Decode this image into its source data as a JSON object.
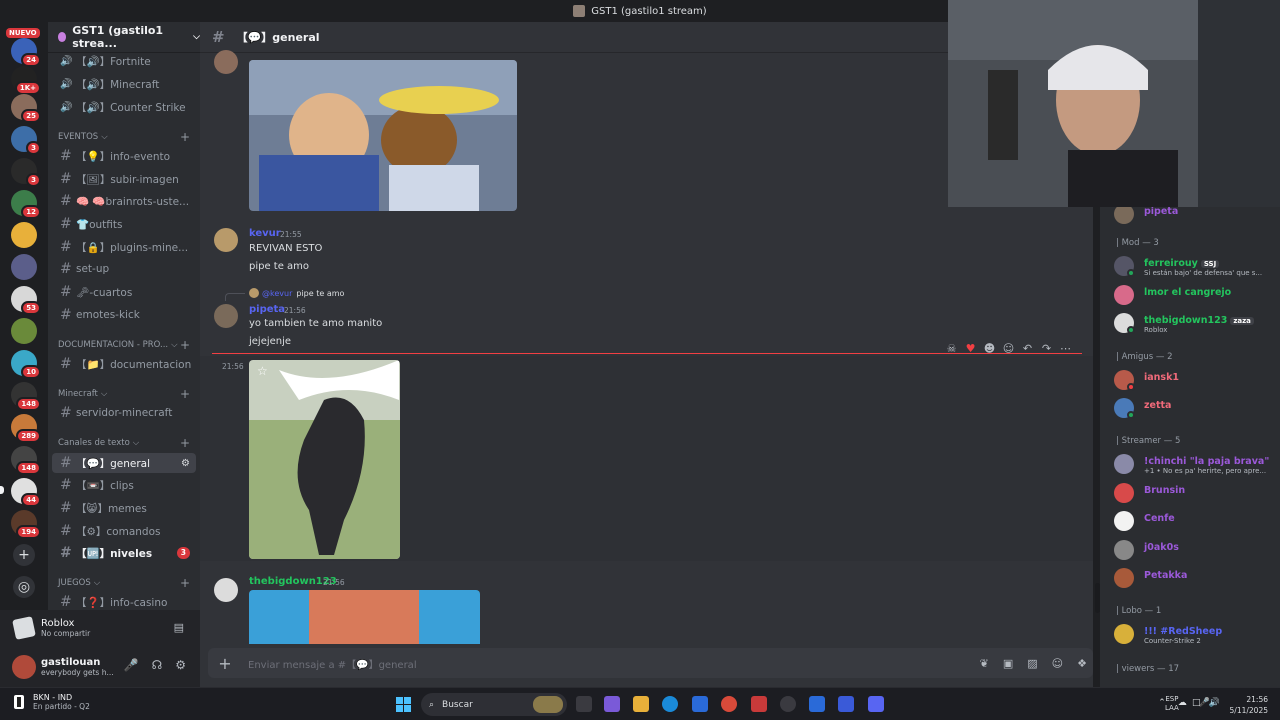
{
  "window": {
    "title": "GST1 (gastilo1 stream)"
  },
  "rail": {
    "new_badge": "NUEVO",
    "badges": [
      "24",
      "1K+",
      "25",
      "3",
      "3",
      "12",
      "53",
      "10",
      "148",
      "289",
      "148",
      "44",
      "194"
    ]
  },
  "server": {
    "name": "GST1 (gastilo1 strea..."
  },
  "channels": {
    "voice": [
      "【🔊】Fortnite",
      "【🔊】Minecraft",
      "【🔊】Counter Strike"
    ],
    "cat_eventos": "EVENTOS",
    "eventos": [
      "【💡】info-evento",
      "【🖼】subir-imagen",
      "🧠 🧠brainrots-uste...",
      "👕outfits",
      "【🔒】plugins-mine...",
      "set-up",
      "🗝-cuartos",
      "emotes-kick"
    ],
    "cat_docs": "DOCUMENTACION - PRO...",
    "docs": [
      "【📁】documentacion"
    ],
    "cat_minecraft": "Minecraft",
    "minecraft": [
      "servidor-minecraft"
    ],
    "cat_texto": "Canales de texto",
    "texto": [
      "【💬】general",
      "【📼】clips",
      "【😸】memes",
      "【⚙】comandos",
      "【🆙】niveles"
    ],
    "niveles_mentions": "3",
    "cat_juegos": "JUEGOS",
    "juegos": [
      "【❓】info-casino"
    ]
  },
  "activity": {
    "game": "Roblox",
    "status": "No compartir"
  },
  "user": {
    "name": "gastilouan",
    "status": "everybody gets h..."
  },
  "channel_header": {
    "name": "【💬】general"
  },
  "messages": [
    {
      "user": "kevur",
      "time": "21:55",
      "lines": [
        "REVIVAN ESTO",
        "pipe te amo"
      ]
    },
    {
      "reply_to_user": "@kevur",
      "reply_text": "pipe te amo",
      "user": "pipeta",
      "time": "21:56",
      "lines": [
        "yo tambien te amo manito",
        "jejejenje"
      ]
    },
    {
      "time": "21:56"
    },
    {
      "user": "thebigdown123",
      "time": "21:56"
    }
  ],
  "composer": {
    "placeholder": "Enviar mensaje a #【💬】general"
  },
  "members": {
    "top_partial": "pipeta",
    "mod_header": "| Mod — 3",
    "mods": [
      {
        "name": "ferreirouy",
        "tag": "SSJ",
        "sub": "Si están bajo' de defensa' que s..."
      },
      {
        "name": "lmor el cangrejo",
        "tag": "",
        "sub": ""
      },
      {
        "name": "thebigdown123",
        "tag": "zaza",
        "sub": "Roblox"
      }
    ],
    "amigos_header": "| Amigus — 2",
    "amigos": [
      {
        "name": "iansk1"
      },
      {
        "name": "zetta"
      }
    ],
    "streamer_header": "| Streamer — 5",
    "streamers": [
      {
        "name": "!chinchi \"la paja brava\"",
        "sub": "+1 • No es pa' herirte, pero apre..."
      },
      {
        "name": "Brunsin",
        "sub": ""
      },
      {
        "name": "Cenfe",
        "sub": ""
      },
      {
        "name": "j0ak0s",
        "sub": ""
      },
      {
        "name": "Petakka",
        "sub": ""
      }
    ],
    "lobo_header": "| Lobo — 1",
    "lobo": [
      {
        "name": "!!! #RedSheep",
        "sub": "Counter-Strike 2"
      }
    ],
    "viewers_header": "| viewers — 17"
  },
  "taskbar": {
    "stock_name": "BKN - IND",
    "stock_sub": "En partido - Q2",
    "search": "Buscar",
    "lang1": "ESP",
    "lang2": "LAA",
    "time": "21:56",
    "date": "5/11/2025"
  },
  "colors": {
    "accent": "#5865f2",
    "mod_green": "#23c55e",
    "streamer_purple": "#9b59d9",
    "unread_red": "#da373c"
  }
}
